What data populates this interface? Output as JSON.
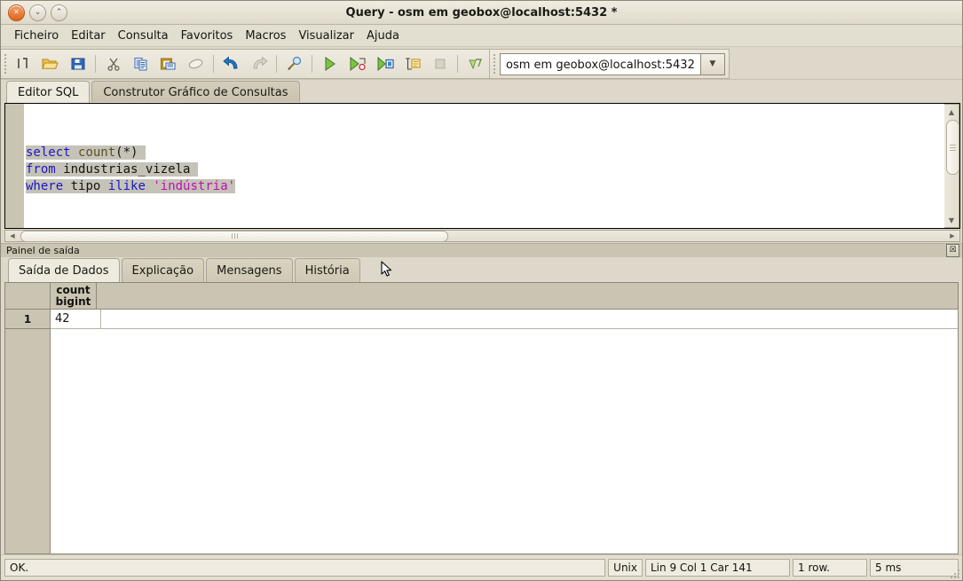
{
  "window": {
    "title": "Query - osm em geobox@localhost:5432 *",
    "controls": [
      {
        "name": "close",
        "glyph": "✕"
      },
      {
        "name": "minimize",
        "glyph": "⌄"
      },
      {
        "name": "maximize",
        "glyph": "⌃"
      }
    ]
  },
  "menubar": {
    "items": [
      "Ficheiro",
      "Editar",
      "Consulta",
      "Favoritos",
      "Macros",
      "Visualizar",
      "Ajuda"
    ]
  },
  "toolbar": {
    "buttons": [
      {
        "name": "new-query-icon",
        "title": "Nova janela"
      },
      {
        "name": "open-file-icon",
        "title": "Abrir ficheiro"
      },
      {
        "name": "save-icon",
        "title": "Gravar"
      },
      {
        "sep": true
      },
      {
        "name": "cut-icon",
        "title": "Cortar"
      },
      {
        "name": "copy-icon",
        "title": "Copiar"
      },
      {
        "name": "paste-icon",
        "title": "Colar"
      },
      {
        "name": "clear-icon",
        "title": "Limpar janela"
      },
      {
        "sep": true
      },
      {
        "name": "undo-icon",
        "title": "Desfazer"
      },
      {
        "name": "redo-icon",
        "title": "Refazer"
      },
      {
        "sep": true
      },
      {
        "name": "find-replace-icon",
        "title": "Procurar"
      },
      {
        "sep": true
      },
      {
        "name": "execute-query-icon",
        "title": "Executar consulta"
      },
      {
        "name": "execute-to-file-icon",
        "title": "Executar para ficheiro"
      },
      {
        "name": "explain-query-icon",
        "title": "Explicar consulta"
      },
      {
        "name": "explain-analyze-icon",
        "title": "Explicar analisar"
      },
      {
        "name": "cancel-query-icon",
        "title": "Cancelar"
      },
      {
        "sep": true
      },
      {
        "name": "macro-icon",
        "title": "Macros"
      }
    ],
    "connection": {
      "value": "osm em geobox@localhost:5432",
      "arrow": "▼"
    }
  },
  "tabs": {
    "items": [
      {
        "label": "Editor SQL",
        "active": true
      },
      {
        "label": "Construtor Gráfico de Consultas",
        "active": false
      }
    ]
  },
  "editor": {
    "lines": [
      {
        "blank": true
      },
      {
        "blank": true
      },
      {
        "tokens": [
          {
            "t": "select",
            "c": "k-kw"
          },
          {
            "t": " ",
            "c": "k-op"
          },
          {
            "t": "count",
            "c": "k-fn"
          },
          {
            "t": "(*)",
            "c": "k-op"
          }
        ]
      },
      {
        "tokens": [
          {
            "t": "from",
            "c": "k-kw"
          },
          {
            "t": " ",
            "c": "k-op"
          },
          {
            "t": "industrias_vizela",
            "c": "k-id"
          }
        ]
      },
      {
        "tokens": [
          {
            "t": "where",
            "c": "k-kw"
          },
          {
            "t": " ",
            "c": "k-op"
          },
          {
            "t": "tipo",
            "c": "k-id"
          },
          {
            "t": " ",
            "c": "k-op"
          },
          {
            "t": "ilike",
            "c": "k-kw"
          },
          {
            "t": " ",
            "c": "k-op"
          },
          {
            "t": "'indústria'",
            "c": "k-str"
          }
        ]
      }
    ],
    "scroll": {
      "up_arrow": "▲",
      "down_arrow": "▼",
      "left_arrow": "◀",
      "right_arrow": "▶"
    }
  },
  "output_panel": {
    "title": "Painel de saída",
    "close_glyph": "☒",
    "tabs": [
      {
        "label": "Saída de Dados",
        "active": true
      },
      {
        "label": "Explicação",
        "active": false
      },
      {
        "label": "Mensagens",
        "active": false
      },
      {
        "label": "História",
        "active": false
      }
    ],
    "grid": {
      "corner_label": "",
      "columns": [
        {
          "name": "count",
          "type": "bigint"
        }
      ],
      "rows": [
        {
          "num": "1",
          "cells": [
            "42"
          ]
        }
      ]
    }
  },
  "statusbar": {
    "message": "OK.",
    "line_ending": "Unix",
    "position": "Lin 9 Col 1 Car 141",
    "rows": "1 row.",
    "duration": "5 ms"
  },
  "colors": {
    "chrome": "#ddd8c9",
    "titlebar": "#e7e2d4",
    "keyword": "#1a17c8",
    "string": "#c010b0",
    "function": "#5a5220",
    "selection": "#c5c2b8",
    "grid_header": "#cac4b2"
  }
}
